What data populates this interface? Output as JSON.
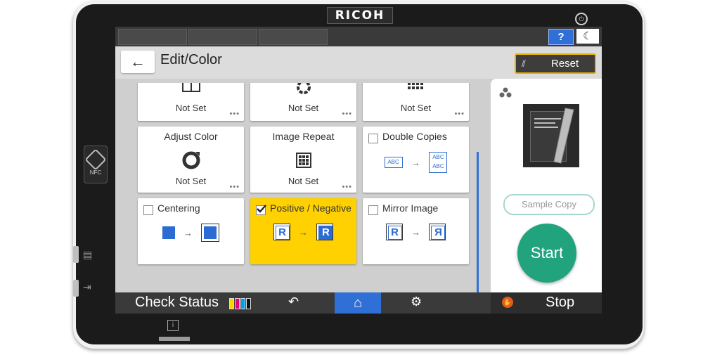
{
  "device": {
    "brand": "RICOH",
    "nfc_label": "NFC"
  },
  "topbar": {
    "help_label": "?",
    "moon_glyph": "☾"
  },
  "header": {
    "back_glyph": "←",
    "title": "Edit/Color",
    "reset_label": "Reset"
  },
  "tiles": {
    "row0": [
      {
        "status": "Not Set"
      },
      {
        "status": "Not Set"
      },
      {
        "status": "Not Set"
      }
    ],
    "adjust_color": {
      "title": "Adjust Color",
      "status": "Not Set"
    },
    "image_repeat": {
      "title": "Image Repeat",
      "status": "Not Set"
    },
    "double_copies": {
      "title": "Double Copies",
      "abc": "ABC"
    },
    "centering": {
      "title": "Centering"
    },
    "positive_negative": {
      "title": "Positive / Negative",
      "r": "R"
    },
    "mirror_image": {
      "title": "Mirror Image",
      "r": "R",
      "r_mirror": "Я"
    }
  },
  "right_panel": {
    "sample_copy_label": "Sample Copy",
    "start_label": "Start"
  },
  "bottombar": {
    "check_status_label": "Check Status",
    "stop_label": "Stop"
  },
  "colors": {
    "accent_blue": "#2f6fd6",
    "selected_yellow": "#ffd100",
    "start_green": "#21a37e",
    "stop_orange": "#e35a1e",
    "reset_border": "#e8b100"
  },
  "icons": [
    "power-icon",
    "nfc-icon",
    "help-icon",
    "moon-icon",
    "back-arrow-icon",
    "reset-icon",
    "adjust-color-icon",
    "image-repeat-icon",
    "toner-icon",
    "undo-icon",
    "home-icon",
    "gear-icon",
    "stop-icon"
  ]
}
